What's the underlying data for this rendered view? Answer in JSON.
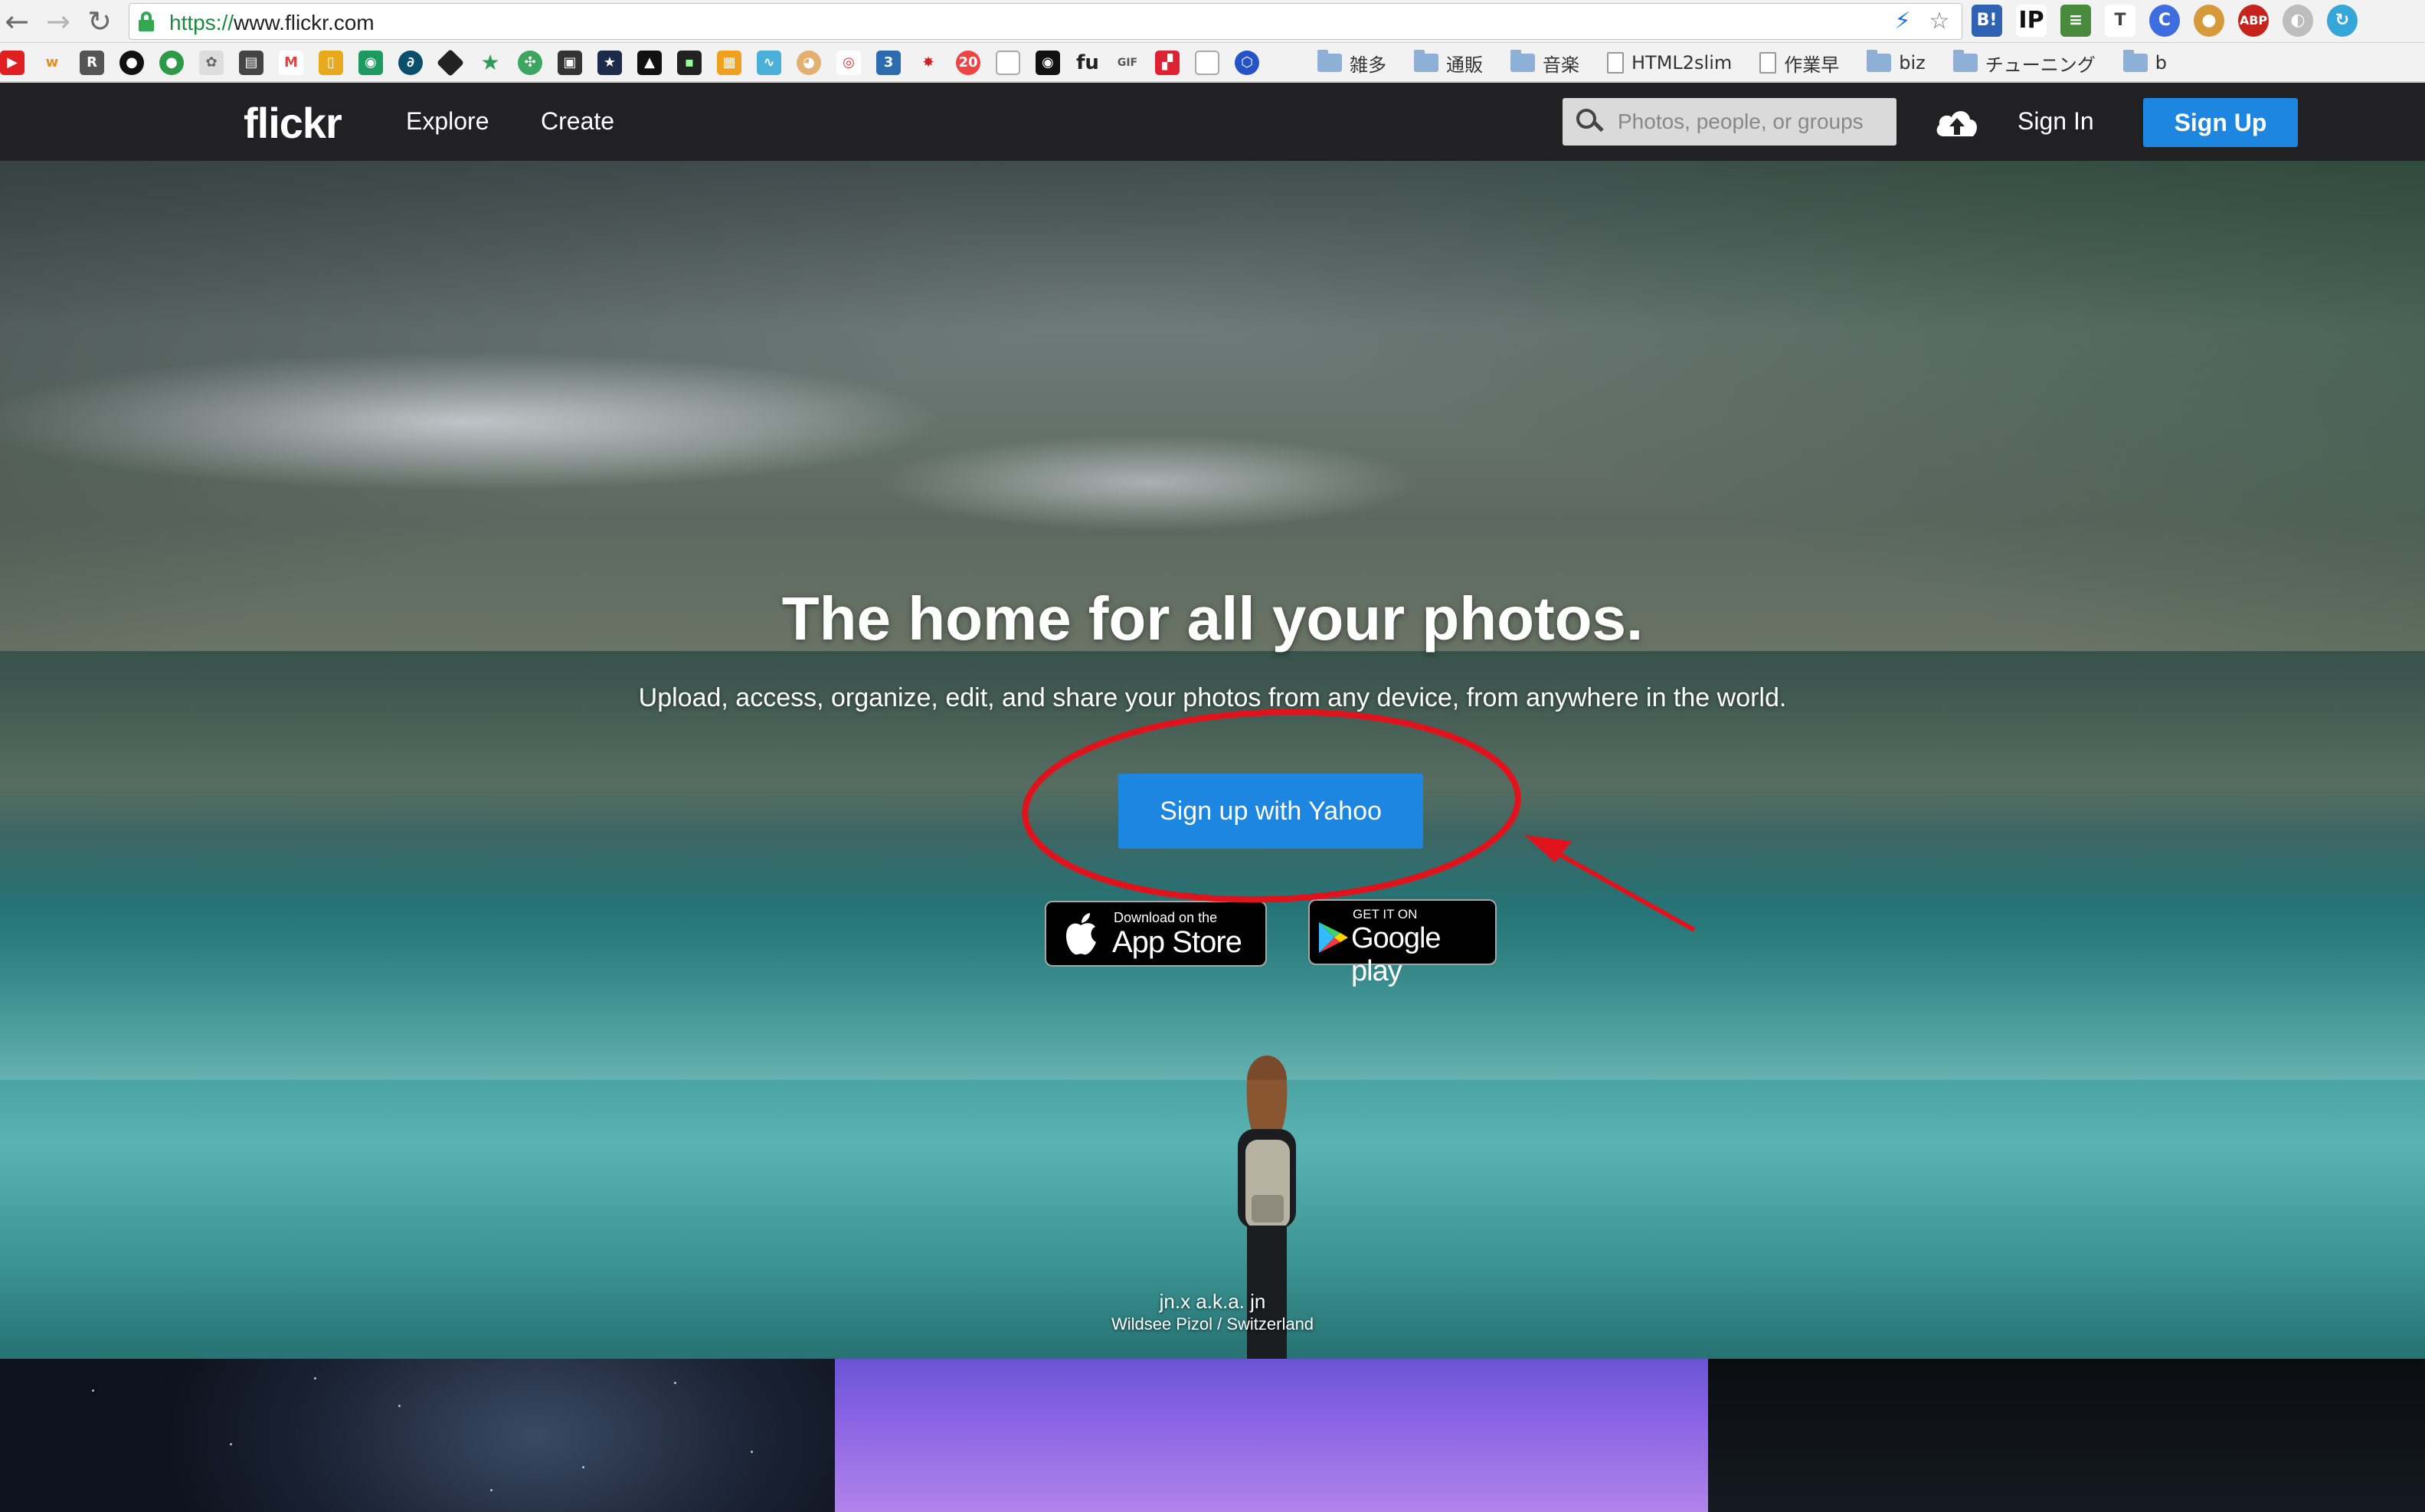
{
  "browser": {
    "url_scheme": "https://",
    "url_rest": "www.flickr.com",
    "bookmark_folders": [
      "雑多",
      "通販",
      "音楽",
      "HTML2slim",
      "作業早",
      "biz",
      "チューニング",
      "b"
    ]
  },
  "nav": {
    "logo": "flickr",
    "explore": "Explore",
    "create": "Create",
    "search_placeholder": "Photos, people, or groups",
    "sign_in": "Sign In",
    "sign_up": "Sign Up"
  },
  "hero": {
    "headline": "The home for all your photos.",
    "subheadline": "Upload, access, organize, edit, and share your photos from any device, from anywhere in the world.",
    "cta": "Sign up with Yahoo",
    "appstore_small": "Download on the",
    "appstore_big": "App Store",
    "play_small": "GET IT ON",
    "play_big": "Google play",
    "credit_name": "jn.x a.k.a. jn",
    "credit_location": "Wildsee Pizol / Switzerland"
  },
  "colors": {
    "brand_blue": "#1c86e0",
    "nav_bg": "#212124",
    "annotation_red": "#e0131c"
  }
}
